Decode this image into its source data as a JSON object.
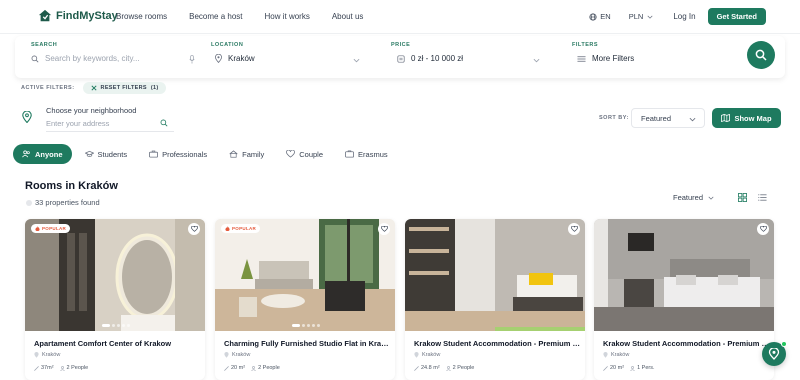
{
  "header": {
    "brand": "FindMyStay",
    "nav": [
      "Browse rooms",
      "Become a host",
      "How it works",
      "About us"
    ],
    "language": "EN",
    "currency": "PLN",
    "login": "Log In",
    "cta": "Get Started"
  },
  "search": {
    "search_label": "SEARCH",
    "search_placeholder": "Search by keywords, city...",
    "location_label": "LOCATION",
    "location_value": "Kraków",
    "price_label": "PRICE",
    "price_value": "0 zł - 10 000 zł",
    "filters_label": "FILTERS",
    "filters_value": "More Filters"
  },
  "active_filters": {
    "label": "ACTIVE FILTERS:",
    "reset": "RESET FILTERS",
    "count": "(1)"
  },
  "neighborhood": {
    "label": "Choose your neighborhood",
    "placeholder": "Enter your address"
  },
  "sort": {
    "label": "SORT BY:",
    "value": "Featured",
    "show_map": "Show Map"
  },
  "tabs": [
    {
      "label": "Anyone",
      "icon": "people-icon",
      "active": true
    },
    {
      "label": "Students",
      "icon": "graduation-cap-icon",
      "active": false
    },
    {
      "label": "Professionals",
      "icon": "briefcase-icon",
      "active": false
    },
    {
      "label": "Family",
      "icon": "home-icon",
      "active": false
    },
    {
      "label": "Couple",
      "icon": "heart-icon",
      "active": false
    },
    {
      "label": "Erasmus",
      "icon": "globe-icon",
      "active": false
    }
  ],
  "results": {
    "title": "Rooms in Kraków",
    "count": "33 properties found",
    "sort": "Featured"
  },
  "cards": [
    {
      "badge": "POPULAR",
      "title": "Apartament Comfort Center of Krakow",
      "location": "Kraków",
      "area": "37m²",
      "people": "2 People"
    },
    {
      "badge": "POPULAR",
      "title": "Charming Fully Furnished Studio Flat in Kraków",
      "location": "Kraków",
      "area": "20 m²",
      "people": "2 People"
    },
    {
      "badge": "",
      "title": "Krakow Student Accommodation - Premium Twi...",
      "location": "Kraków",
      "area": "24.8 m²",
      "people": "2 People"
    },
    {
      "badge": "",
      "title": "Krakow Student Accommodation - Premium Sin...",
      "location": "Kraków",
      "area": "20 m²",
      "people": "1 Pers."
    }
  ],
  "colors": {
    "brand": "#1e7a5f",
    "badge": "#e55a3c"
  }
}
